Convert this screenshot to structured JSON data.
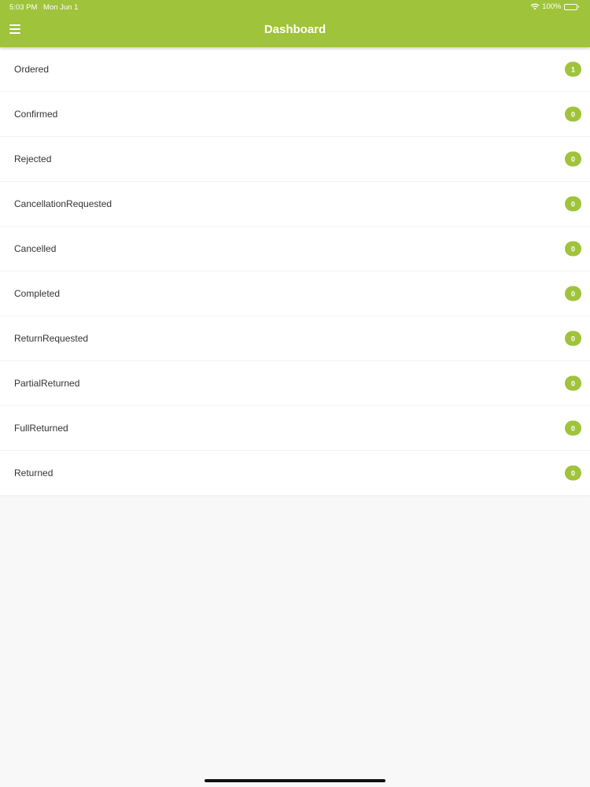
{
  "status_bar": {
    "time": "5:03 PM",
    "date": "Mon Jun 1",
    "battery": "100%",
    "wifi_icon": "wifi-icon",
    "battery_icon": "battery-icon"
  },
  "header": {
    "title": "Dashboard",
    "menu_icon": "hamburger-menu-icon",
    "background_color": "#9fc33a"
  },
  "list": {
    "badge_color": "#9fc33a",
    "items": [
      {
        "label": "Ordered",
        "count": "1"
      },
      {
        "label": "Confirmed",
        "count": "0"
      },
      {
        "label": "Rejected",
        "count": "0"
      },
      {
        "label": "CancellationRequested",
        "count": "0"
      },
      {
        "label": "Cancelled",
        "count": "0"
      },
      {
        "label": "Completed",
        "count": "0"
      },
      {
        "label": "ReturnRequested",
        "count": "0"
      },
      {
        "label": "PartialReturned",
        "count": "0"
      },
      {
        "label": "FullReturned",
        "count": "0"
      },
      {
        "label": "Returned",
        "count": "0"
      }
    ]
  }
}
